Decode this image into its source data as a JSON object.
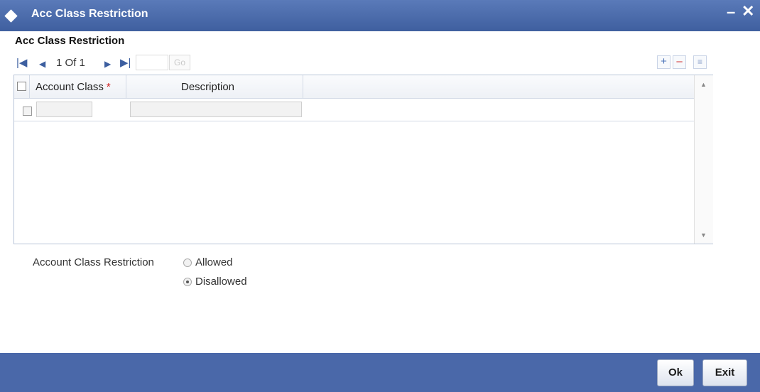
{
  "window": {
    "title": "Acc Class Restriction",
    "minimize_glyph": "–",
    "close_glyph": "✕",
    "header_color": "#4a68a9"
  },
  "section": {
    "title": "Acc Class Restriction"
  },
  "pager": {
    "label": "1 Of 1",
    "page_input_value": "",
    "go_label": "Go",
    "icons": [
      "first-page-icon",
      "prev-page-icon",
      "next-page-icon",
      "last-page-icon"
    ]
  },
  "grid_toolbar": {
    "add_glyph": "+",
    "delete_glyph": "–",
    "list_glyph": "≡"
  },
  "grid": {
    "columns": [
      {
        "label": "Account Class",
        "required_marker": "*"
      },
      {
        "label": "Description"
      }
    ],
    "rows": [
      {
        "account_class": "",
        "description": ""
      }
    ]
  },
  "restriction": {
    "label": "Account Class Restriction",
    "options": [
      {
        "label": "Allowed",
        "selected": false
      },
      {
        "label": "Disallowed",
        "selected": true
      }
    ]
  },
  "footer": {
    "ok_label": "Ok",
    "exit_label": "Exit"
  }
}
